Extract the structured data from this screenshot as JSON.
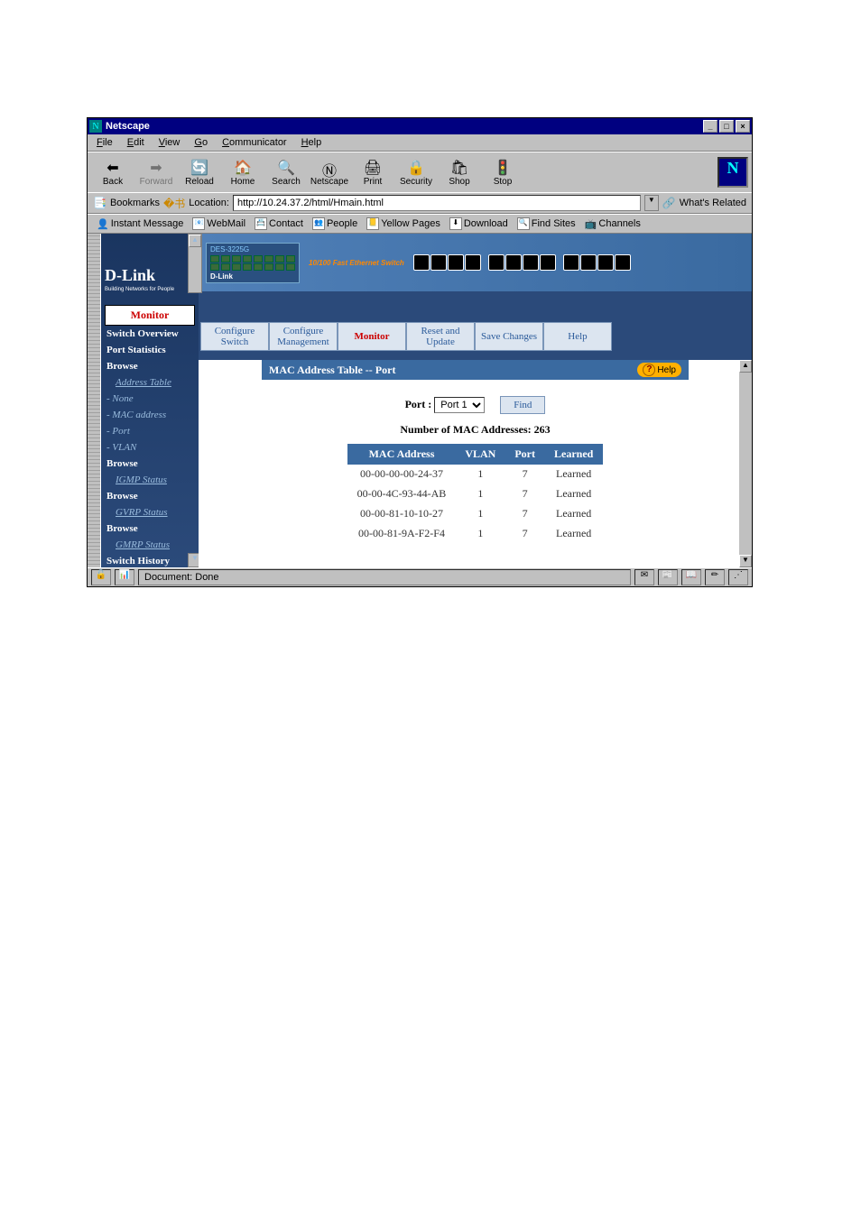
{
  "window": {
    "app": "Netscape"
  },
  "menu": {
    "file": "File",
    "edit": "Edit",
    "view": "View",
    "go": "Go",
    "communicator": "Communicator",
    "help": "Help"
  },
  "toolbar": {
    "back": "Back",
    "forward": "Forward",
    "reload": "Reload",
    "home": "Home",
    "search": "Search",
    "netscape": "Netscape",
    "print": "Print",
    "security": "Security",
    "shop": "Shop",
    "stop": "Stop"
  },
  "location": {
    "bookmarks": "Bookmarks",
    "label": "Location:",
    "url": "http://10.24.37.2/html/Hmain.html",
    "related": "What's Related"
  },
  "ptb": {
    "im": "Instant Message",
    "webmail": "WebMail",
    "contact": "Contact",
    "people": "People",
    "yp": "Yellow Pages",
    "download": "Download",
    "find": "Find Sites",
    "channels": "Channels"
  },
  "brand": {
    "logo": "D-Link",
    "sub": "Building Networks for People",
    "model": "DES-3225G",
    "desc": "10/100 Fast Ethernet Switch"
  },
  "sidebar": {
    "items": [
      {
        "label": "Monitor",
        "cls": "act"
      },
      {
        "label": "Switch Overview",
        "cls": "h"
      },
      {
        "label": "Port Statistics",
        "cls": "h"
      },
      {
        "label": "Browse",
        "cls": "h"
      },
      {
        "label": "Address Table",
        "cls": "sub"
      },
      {
        "label": "None",
        "cls": "mrk"
      },
      {
        "label": "MAC address",
        "cls": "mrk"
      },
      {
        "label": "Port",
        "cls": "mrk"
      },
      {
        "label": "VLAN",
        "cls": "mrk"
      },
      {
        "label": "Browse",
        "cls": "h"
      },
      {
        "label": "IGMP Status",
        "cls": "sub"
      },
      {
        "label": "Browse",
        "cls": "h"
      },
      {
        "label": "GVRP Status",
        "cls": "sub"
      },
      {
        "label": "Browse",
        "cls": "h"
      },
      {
        "label": "GMRP Status",
        "cls": "sub"
      },
      {
        "label": "Switch History",
        "cls": "h"
      }
    ]
  },
  "nav": [
    {
      "label": "Configure Switch"
    },
    {
      "label": "Configure Management"
    },
    {
      "label": "Monitor",
      "active": true
    },
    {
      "label": "Reset and Update"
    },
    {
      "label": "Save Changes"
    },
    {
      "label": "Help"
    }
  ],
  "panel": {
    "title": "MAC Address Table -- Port",
    "help": "Help",
    "port_label": "Port :",
    "port_value": "Port 1",
    "find": "Find",
    "count_label": "Number of MAC Addresses:",
    "count": "263",
    "headers": {
      "mac": "MAC Address",
      "vlan": "VLAN",
      "port": "Port",
      "learned": "Learned"
    },
    "rows": [
      {
        "mac": "00-00-00-00-24-37",
        "vlan": "1",
        "port": "7",
        "learned": "Learned"
      },
      {
        "mac": "00-00-4C-93-44-AB",
        "vlan": "1",
        "port": "7",
        "learned": "Learned"
      },
      {
        "mac": "00-00-81-10-10-27",
        "vlan": "1",
        "port": "7",
        "learned": "Learned"
      },
      {
        "mac": "00-00-81-9A-F2-F4",
        "vlan": "1",
        "port": "7",
        "learned": "Learned"
      }
    ]
  },
  "status": {
    "msg": "Document: Done"
  }
}
